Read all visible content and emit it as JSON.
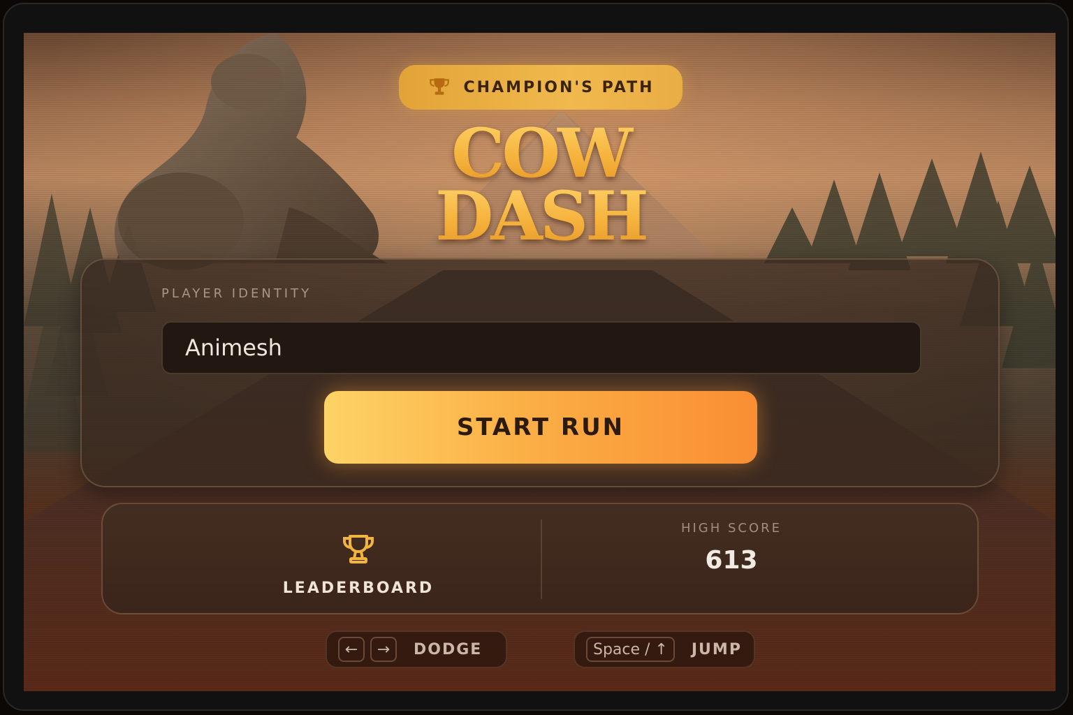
{
  "badge": {
    "label": "CHAMPION'S PATH",
    "icon": "trophy-icon"
  },
  "title": {
    "line1": "COW",
    "line2": "DASH"
  },
  "player": {
    "label": "PLAYER IDENTITY",
    "name": "Animesh"
  },
  "start_button": {
    "label": "START RUN"
  },
  "stats": {
    "leaderboard_label": "LEADERBOARD",
    "leaderboard_icon": "trophy-icon",
    "high_score_label": "HIGH SCORE",
    "high_score_value": "613"
  },
  "controls": {
    "dodge": {
      "keys": [
        "←",
        "→"
      ],
      "label": "DODGE"
    },
    "jump": {
      "key": "Space / ↑",
      "label": "JUMP"
    }
  },
  "colors": {
    "accent": "#f5b33c",
    "button_start": "#fdd366",
    "button_end": "#f98e33",
    "panel": "#3c2c22"
  }
}
